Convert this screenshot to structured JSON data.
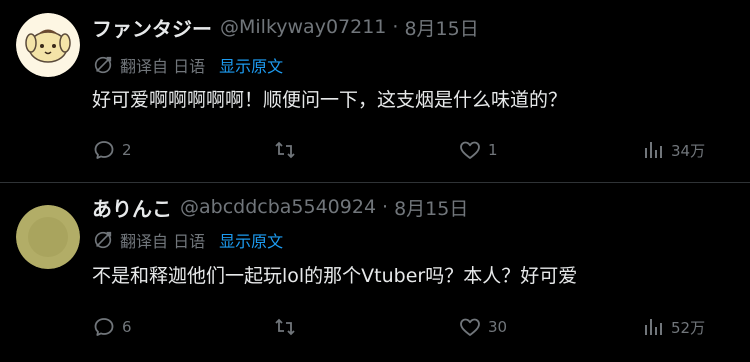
{
  "tweets": [
    {
      "display_name": "ファンタジー",
      "handle": "@Milkyway07211",
      "separator": "·",
      "date": "8月15日",
      "translated_from": "翻译自 日语",
      "show_original": "显示原文",
      "text": "好可爱啊啊啊啊啊！顺便问一下，这支烟是什么味道的？",
      "replies": "2",
      "retweets": "",
      "likes": "1",
      "views": "34万",
      "avatar_color": "#fdf6e3"
    },
    {
      "display_name": "ありんこ",
      "handle": "@abcddcba5540924",
      "separator": "·",
      "date": "8月15日",
      "translated_from": "翻译自 日语",
      "show_original": "显示原文",
      "text": "不是和释迦他们一起玩lol的那个Vtuber吗？本人？好可爱",
      "replies": "6",
      "retweets": "",
      "likes": "30",
      "views": "52万",
      "avatar_color": "#b2ad67"
    }
  ],
  "colors": {
    "background": "#000000",
    "text_primary": "#e7e9ea",
    "text_secondary": "#71767b",
    "link": "#1d9bf0",
    "divider": "#2f3336"
  },
  "icons": [
    "translate-icon",
    "reply-icon",
    "retweet-icon",
    "like-icon",
    "views-icon"
  ]
}
